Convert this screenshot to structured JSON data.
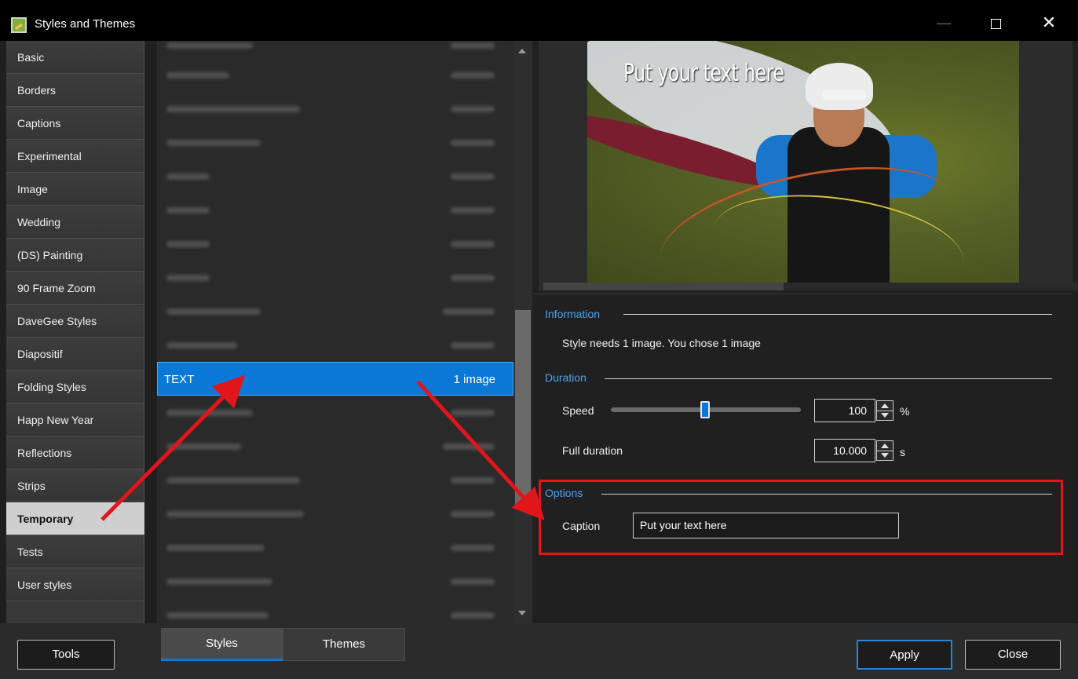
{
  "window": {
    "title": "Styles and Themes",
    "controls": {
      "minimize": "—",
      "close": "✕"
    }
  },
  "sidebar": {
    "items": [
      "Basic",
      "Borders",
      "Captions",
      "Experimental",
      "Image",
      "Wedding",
      "(DS) Painting",
      "90 Frame Zoom",
      "DaveGee Styles",
      "Diapositif",
      "Folding Styles",
      "Happ New Year",
      "Reflections",
      "Strips",
      "Temporary",
      "Tests",
      "User styles"
    ],
    "active": "Temporary"
  },
  "styles_list": {
    "selected_row": {
      "name": "TEXT",
      "count": "1 image"
    },
    "blurred_rows_above": 10,
    "blurred_rows_below": 6
  },
  "preview": {
    "caption_overlay": "Put your text here"
  },
  "information": {
    "title": "Information",
    "text": "Style needs 1 image. You chose 1 image"
  },
  "duration": {
    "title": "Duration",
    "speed_label": "Speed",
    "speed_value": "100",
    "speed_unit": "%",
    "full_duration_label": "Full duration",
    "full_duration_value": "10.000",
    "full_duration_unit": "s"
  },
  "options": {
    "title": "Options",
    "caption_label": "Caption",
    "caption_value": "Put your text here"
  },
  "bottom": {
    "tools": "Tools",
    "tabs": [
      "Styles",
      "Themes"
    ],
    "apply": "Apply",
    "close": "Close"
  },
  "colors": {
    "accent": "#0a78d7",
    "section_title": "#4aa3f0",
    "annotation": "#e0161b"
  }
}
